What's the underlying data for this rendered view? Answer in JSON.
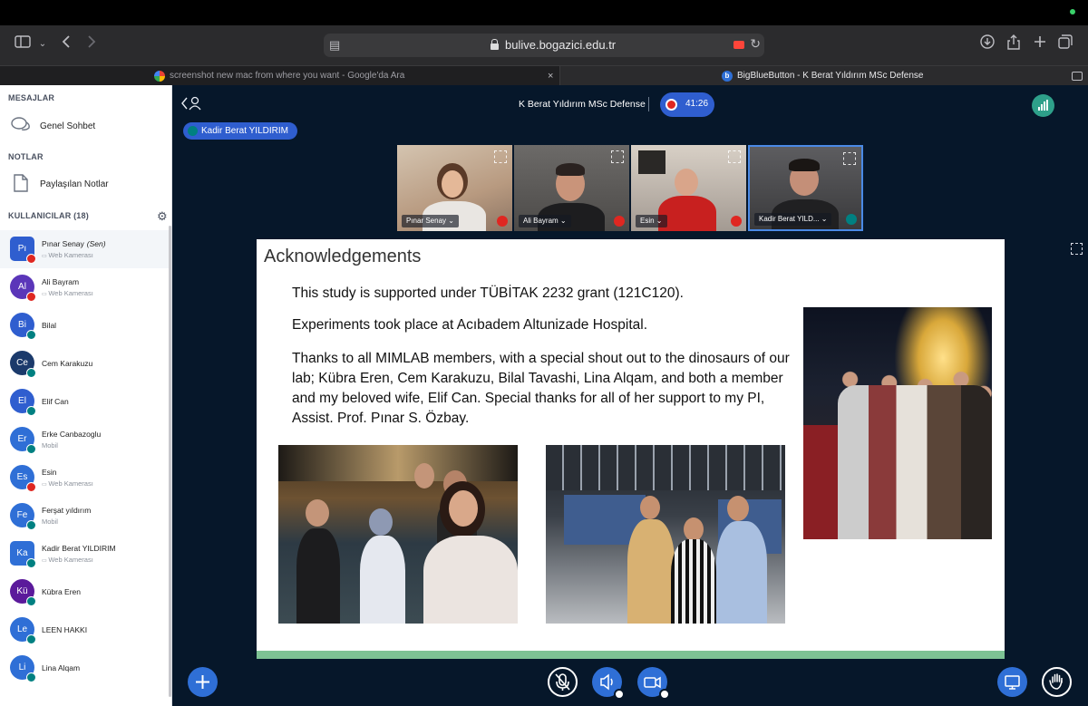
{
  "browser": {
    "url": "bulive.bogazici.edu.tr",
    "tabs": [
      {
        "title": "screenshot new mac from where you want - Google'da Ara",
        "close": "×"
      },
      {
        "title": "BigBlueButton - K Berat Yıldırım MSc Defense"
      }
    ]
  },
  "sidebar": {
    "messages_title": "MESAJLAR",
    "public_chat": "Genel Sohbet",
    "notes_title": "NOTLAR",
    "shared_notes": "Paylaşılan Notlar",
    "users_title": "KULLANICILAR (18)",
    "users": [
      {
        "initials": "Pı",
        "name": "Pınar Senay",
        "you": "(Sen)",
        "sub": "Web Kamerası",
        "color": "#2f5ecf",
        "status": "muted"
      },
      {
        "initials": "Al",
        "name": "Ali Bayram",
        "sub": "Web Kamerası",
        "color": "#5b36b9",
        "status": "muted"
      },
      {
        "initials": "Bi",
        "name": "Bilal",
        "sub": "",
        "color": "#2f5ecf",
        "status": "on"
      },
      {
        "initials": "Ce",
        "name": "Cem Karakuzu",
        "sub": "",
        "color": "#1b3a6b",
        "status": "on"
      },
      {
        "initials": "El",
        "name": "Elif Can",
        "sub": "",
        "color": "#2f5ecf",
        "status": "on"
      },
      {
        "initials": "Er",
        "name": "Erke Canbazoglu",
        "sub": "Mobil",
        "color": "#2f6fd6",
        "status": "on"
      },
      {
        "initials": "Es",
        "name": "Esin",
        "sub": "Web Kamerası",
        "color": "#2f6fd6",
        "status": "muted"
      },
      {
        "initials": "Fe",
        "name": "Ferşat yıldırım",
        "sub": "Mobil",
        "color": "#2f6fd6",
        "status": "on"
      },
      {
        "initials": "Ka",
        "name": "Kadir Berat YILDIRIM",
        "sub": "Web Kamerası",
        "color": "#2f6fd6",
        "status": "on"
      },
      {
        "initials": "Kü",
        "name": "Kübra Eren",
        "sub": "",
        "color": "#5b1a9b",
        "status": "on"
      },
      {
        "initials": "Le",
        "name": "LEEN HAKKI",
        "sub": "",
        "color": "#2f6fd6",
        "status": "on"
      },
      {
        "initials": "Li",
        "name": "Lina Alqam",
        "sub": "",
        "color": "#2f6fd6",
        "status": "on"
      }
    ]
  },
  "meeting": {
    "title": "K Berat Yıldırım MSc Defense",
    "timer": "41:26",
    "current_speaker": "Kadir Berat YILDIRIM",
    "videos": [
      {
        "name": "Pınar Senay ⌄",
        "status": "muted"
      },
      {
        "name": "Ali Bayram ⌄",
        "status": "muted"
      },
      {
        "name": "Esin ⌄",
        "status": "muted"
      },
      {
        "name": "Kadir Berat YILD... ⌄",
        "status": "on"
      }
    ]
  },
  "slide": {
    "title": "Acknowledgements",
    "p1": "This study is supported under TÜBİTAK 2232 grant (121C120).",
    "p2": "Experiments took place at Acıbadem Altunizade Hospital.",
    "p3": "Thanks to all MIMLAB members, with a special shout out to the dinosaurs of our lab; Kübra Eren, Cem Karakuzu, Bilal Tavashi, Lina Alqam, and both a member and my beloved wife, Elif Can. Special thanks for all of her support to my PI, Assist. Prof. Pınar S. Özbay."
  },
  "colors": {
    "brand_blue": "#2f5ecf",
    "muted_red": "#df2721",
    "active_teal": "#008081",
    "main_bg": "#06172a",
    "slide_bar": "#7dc294"
  },
  "icons": {
    "sidebar_toggle": "sidebar-icon",
    "back": "chevron-left-icon",
    "forward": "chevron-right-icon",
    "download": "download-icon",
    "share": "share-icon",
    "new_tab": "plus-icon",
    "tabs_overview": "tabs-icon",
    "chat": "chat-bubbles-icon",
    "notes": "notes-icon",
    "settings": "gear-icon",
    "mute": "microphone-muted-icon",
    "audio": "speaker-icon",
    "camera": "camera-icon",
    "actions": "plus-icon",
    "presentation": "screen-icon",
    "raise_hand": "hand-icon"
  }
}
